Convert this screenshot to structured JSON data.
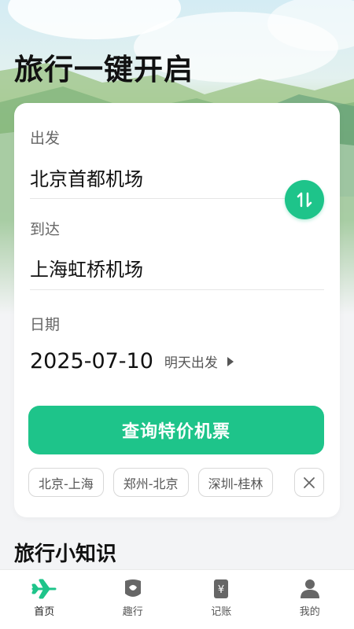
{
  "header": {
    "title": "旅行一键开启"
  },
  "search_card": {
    "departure": {
      "label": "出发",
      "value": "北京首都机场"
    },
    "arrival": {
      "label": "到达",
      "value": "上海虹桥机场"
    },
    "date": {
      "label": "日期",
      "value": "2025-07-10",
      "hint": "明天出发"
    },
    "search_button_label": "查询特价机票",
    "history": [
      "北京-上海",
      "郑州-北京",
      "深圳-桂林"
    ]
  },
  "sections": {
    "tips_title": "旅行小知识"
  },
  "tabbar": {
    "items": [
      {
        "label": "首页",
        "icon": "plane-icon",
        "active": true
      },
      {
        "label": "趣行",
        "icon": "shield-icon",
        "active": false
      },
      {
        "label": "记账",
        "icon": "ledger-icon",
        "active": false
      },
      {
        "label": "我的",
        "icon": "user-icon",
        "active": false
      }
    ]
  },
  "colors": {
    "accent": "#1ec48a",
    "background": "#f3f4f6"
  }
}
